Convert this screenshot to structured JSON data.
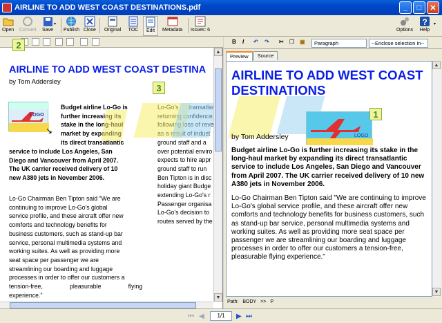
{
  "window": {
    "title": "AIRLINE TO ADD WEST COAST DESTINATIONS.pdf"
  },
  "toolbar": {
    "open": "Open",
    "convert": "Convert",
    "save": "Save",
    "publish": "Publish",
    "close": "Close",
    "original": "Original",
    "toc": "TOC",
    "edit": "Edit",
    "metadata": "Metadata",
    "issues": "Issues: 6",
    "options": "Options",
    "help": "Help"
  },
  "markers": {
    "m1": "1",
    "m2": "2",
    "m3": "3"
  },
  "document": {
    "headline": "AIRLINE TO ADD WEST COAST DESTINA",
    "byline": "by Tom Addersley",
    "logo_text": "LOGO",
    "lead_right": [
      "Budget airline Lo-Go is",
      "further increasing its",
      "stake in the long-haul",
      "market by expanding",
      "its direct transatlantic"
    ],
    "lead_full": [
      "service to include Los Angeles, San",
      "Diego and Vancouver from April 2007.",
      "The UK carrier received delivery of 10",
      "new A380 jets in November 2006."
    ],
    "para1": [
      "Lo-Go Chairman Ben Tipton said “We are",
      "continuing to improve Lo-Go's global",
      "service profile, and these aircraft offer new",
      "comforts and technology benefits for",
      "business customers, such as stand-up bar",
      "service, personal multimedia systems and",
      "working suites. As well as providing more",
      "seat space per passenger we are",
      "streamlining our boarding and luggage",
      "processes in order to offer our customers a",
      "tension-free,                pleasurable                flying",
      "experience.”"
    ],
    "col2": [
      "Lo-Go's      transatlan",
      "returning confidence",
      "following loss of reve",
      "as a result of indust",
      "ground staff and a",
      "over potential enviro",
      "expects to hire appr",
      "ground staff to run",
      "Ben Tipton is in disc",
      "holiday giant Budge",
      "extending Lo-Go's r",
      "Passenger organisa",
      "Lo-Go's decision to",
      "routes served by the"
    ]
  },
  "editor": {
    "bold": "B",
    "italic": "I",
    "style_select": "Paragraph",
    "enclose_select": "--Enclose selection in--",
    "tab_preview": "Preview",
    "tab_source": "Source",
    "headline": "AIRLINE TO ADD WEST COAST DESTINATIONS",
    "byline": "by Tom Addersley",
    "logo_text": "LOGO",
    "lead": "Budget airline Lo-Go is further increasing its stake in the long-haul market by expanding its direct transatlantic service to include Los Angeles, San Diego and Vancouver from April 2007. The UK carrier received delivery of 10 new A380 jets in November 2006.",
    "para": "Lo-Go Chairman Ben Tipton said \"We are continuing to improve Lo-Go's global service profile, and these aircraft offer new comforts and technology benefits for business customers, such as stand-up bar service, personal multimedia systems and working suites. As well as providing more seat space per passenger we are streamlining our boarding and luggage processes in order to offer our customers a tension-free, pleasurable flying experience.\"",
    "path_label": "Path:",
    "path_body": "BODY",
    "path_sep": ">>",
    "path_p": "P"
  },
  "status": {
    "page": "1/1"
  },
  "colors": {
    "headline": "#0a1ee6",
    "titlebar": "#0046c8",
    "marker": "#f3f39a"
  }
}
